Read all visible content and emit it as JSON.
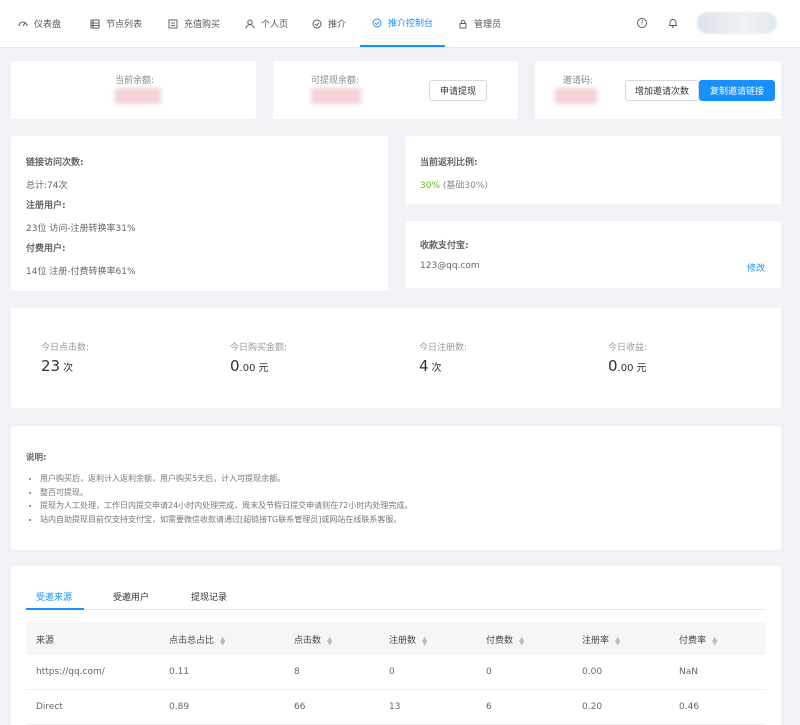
{
  "nav": {
    "items": [
      {
        "label": "仪表盘",
        "icon": "dashboard-icon"
      },
      {
        "label": "节点列表",
        "icon": "list-icon"
      },
      {
        "label": "充值购买",
        "icon": "shop-icon"
      },
      {
        "label": "个人页",
        "icon": "user-icon"
      },
      {
        "label": "推介",
        "icon": "check-circle-icon"
      },
      {
        "label": "推介控制台",
        "icon": "check-circle-icon",
        "active": true
      },
      {
        "label": "管理员",
        "icon": "lock-icon"
      }
    ],
    "right_icons": [
      "help-icon",
      "bell-icon"
    ]
  },
  "balance": {
    "current_label": "当前余额:",
    "withdrawable_label": "可提现余额:",
    "withdraw_button": "申请提现",
    "invite_code_label": "邀请码:",
    "add_invite_button": "增加邀请次数",
    "copy_link_button": "复制邀请链接"
  },
  "link_stats": {
    "visits_title": "链接访问次数:",
    "visits_total": "总计:74次",
    "registered_title": "注册用户:",
    "registered_detail": "23位 访问-注册转换率31%",
    "paid_title": "付费用户:",
    "paid_detail": "14位 注册-付费转换率61%"
  },
  "rebate": {
    "title": "当前返利比例:",
    "rate": "30%",
    "note": "(基础30%)"
  },
  "alipay": {
    "title": "收款支付宝:",
    "account": "123@qq.com",
    "edit": "修改"
  },
  "today": [
    {
      "label": "今日点击数:",
      "value": "23",
      "decimal": "",
      "unit": "次"
    },
    {
      "label": "今日购买金额:",
      "value": "0",
      "decimal": ".00",
      "unit": "元"
    },
    {
      "label": "今日注册数:",
      "value": "4",
      "decimal": "",
      "unit": "次"
    },
    {
      "label": "今日收益:",
      "value": "0",
      "decimal": ".00",
      "unit": "元"
    }
  ],
  "notes": {
    "title": "说明:",
    "items": [
      "用户购买后，返利计入返利余额，用户购买5天后，计入可提现余额。",
      "整百可提现。",
      "提现为人工处理，工作日内提交申请24小时内处理完成，周末及节假日提交申请则在72小时内处理完成。",
      "站内自助提现目前仅支持支付宝，如需要微信收款请通过[超链接TG联系管理员]或网站在线联系客服。"
    ]
  },
  "tabs": [
    "受邀来源",
    "受邀用户",
    "提现记录"
  ],
  "table": {
    "headers": [
      "来源",
      "点击总占比",
      "点击数",
      "注册数",
      "付费数",
      "注册率",
      "付费率"
    ],
    "rows": [
      [
        "https://qq.com/",
        "0.11",
        "8",
        "0",
        "0",
        "0.00",
        "NaN"
      ],
      [
        "Direct",
        "0.89",
        "66",
        "13",
        "6",
        "0.20",
        "0.46"
      ]
    ]
  },
  "colors": {
    "accent": "#1890ff",
    "positive": "#52c41a"
  }
}
